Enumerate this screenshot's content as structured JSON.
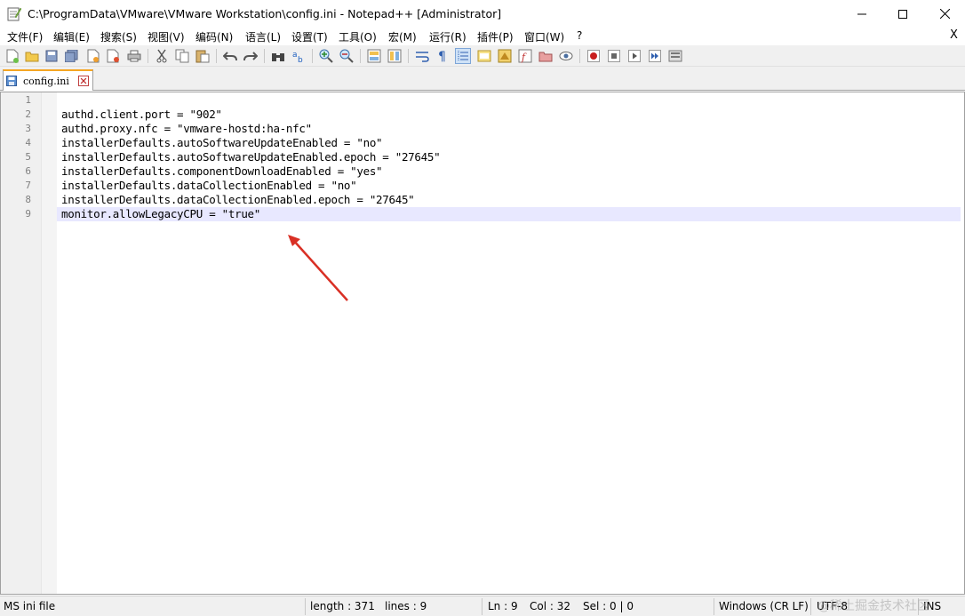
{
  "window": {
    "title": "C:\\ProgramData\\VMware\\VMware Workstation\\config.ini - Notepad++ [Administrator]"
  },
  "menu": {
    "items": [
      "文件(F)",
      "编辑(E)",
      "搜索(S)",
      "视图(V)",
      "编码(N)",
      "语言(L)",
      "设置(T)",
      "工具(O)",
      "宏(M)",
      "运行(R)",
      "插件(P)",
      "窗口(W)",
      "?"
    ],
    "close_doc": "X"
  },
  "tab": {
    "label": "config.ini"
  },
  "editor": {
    "lines": [
      {
        "num": "1",
        "text": ""
      },
      {
        "num": "2",
        "text": "authd.client.port = \"902\""
      },
      {
        "num": "3",
        "text": "authd.proxy.nfc = \"vmware-hostd:ha-nfc\""
      },
      {
        "num": "4",
        "text": "installerDefaults.autoSoftwareUpdateEnabled = \"no\""
      },
      {
        "num": "5",
        "text": "installerDefaults.autoSoftwareUpdateEnabled.epoch = \"27645\""
      },
      {
        "num": "6",
        "text": "installerDefaults.componentDownloadEnabled = \"yes\""
      },
      {
        "num": "7",
        "text": "installerDefaults.dataCollectionEnabled = \"no\""
      },
      {
        "num": "8",
        "text": "installerDefaults.dataCollectionEnabled.epoch = \"27645\""
      },
      {
        "num": "9",
        "text": "monitor.allowLegacyCPU = \"true\""
      }
    ],
    "current_line": 9
  },
  "status": {
    "file_type": "MS ini file",
    "length": "length : 371",
    "lines": "lines : 9",
    "ln": "Ln : 9",
    "col": "Col : 32",
    "sel": "Sel : 0 | 0",
    "eol": "Windows (CR LF)",
    "encoding": "UTF-8",
    "mode": "INS"
  },
  "watermark": "@稀土掘金技术社区",
  "colors": {
    "arrow": "#d93025",
    "tab_accent": "#f5a623",
    "current_line": "#e8e8ff"
  }
}
